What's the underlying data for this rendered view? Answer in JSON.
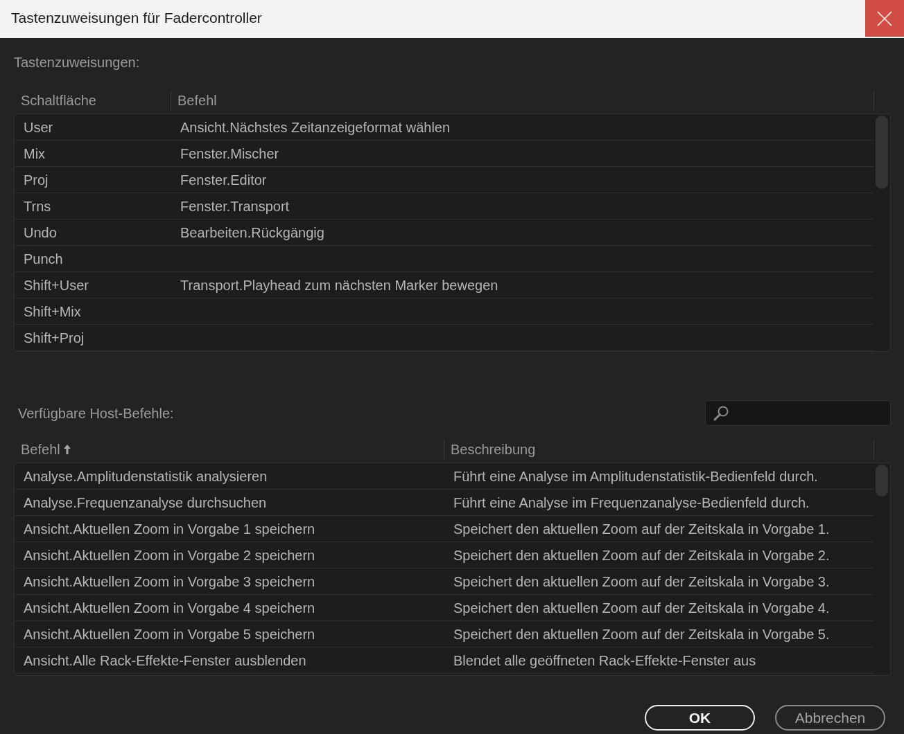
{
  "window": {
    "title": "Tastenzuweisungen für Fadercontroller"
  },
  "assignments": {
    "label": "Tastenzuweisungen:",
    "columns": [
      "Schaltfläche",
      "Befehl"
    ],
    "rows": [
      {
        "button": "User",
        "command": "Ansicht.Nächstes Zeitanzeigeformat wählen"
      },
      {
        "button": "Mix",
        "command": "Fenster.Mischer"
      },
      {
        "button": "Proj",
        "command": "Fenster.Editor"
      },
      {
        "button": "Trns",
        "command": "Fenster.Transport"
      },
      {
        "button": "Undo",
        "command": "Bearbeiten.Rückgängig"
      },
      {
        "button": "Punch"
      },
      {
        "button": "Shift+User",
        "command": "Transport.Playhead zum nächsten Marker bewegen"
      },
      {
        "button": "Shift+Mix"
      },
      {
        "button": "Shift+Proj"
      }
    ]
  },
  "host_commands": {
    "label": "Verfügbare Host-Befehle:",
    "columns": [
      {
        "label": "Befehl",
        "sorted": true
      },
      {
        "label": "Beschreibung",
        "sorted": false
      }
    ],
    "rows": [
      {
        "command": "Analyse.Amplitudenstatistik analysieren",
        "description": "Führt eine Analyse im Amplitudenstatistik-Bedienfeld durch."
      },
      {
        "command": "Analyse.Frequenzanalyse durchsuchen",
        "description": "Führt eine Analyse im Frequenzanalyse-Bedienfeld durch."
      },
      {
        "command": "Ansicht.Aktuellen Zoom in Vorgabe 1 speichern",
        "description": "Speichert den aktuellen Zoom auf der Zeitskala in Vorgabe 1."
      },
      {
        "command": "Ansicht.Aktuellen Zoom in Vorgabe 2 speichern",
        "description": "Speichert den aktuellen Zoom auf der Zeitskala in Vorgabe 2."
      },
      {
        "command": "Ansicht.Aktuellen Zoom in Vorgabe 3 speichern",
        "description": "Speichert den aktuellen Zoom auf der Zeitskala in Vorgabe 3."
      },
      {
        "command": "Ansicht.Aktuellen Zoom in Vorgabe 4 speichern",
        "description": "Speichert den aktuellen Zoom auf der Zeitskala in Vorgabe 4."
      },
      {
        "command": "Ansicht.Aktuellen Zoom in Vorgabe 5 speichern",
        "description": "Speichert den aktuellen Zoom auf der Zeitskala in Vorgabe 5."
      },
      {
        "command": "Ansicht.Alle Rack-Effekte-Fenster ausblenden",
        "description": "Blendet alle geöffneten Rack-Effekte-Fenster aus"
      }
    ]
  },
  "buttons": [
    {
      "label": "OK",
      "primary": true
    },
    {
      "label": "Abbrechen",
      "primary": false
    }
  ]
}
